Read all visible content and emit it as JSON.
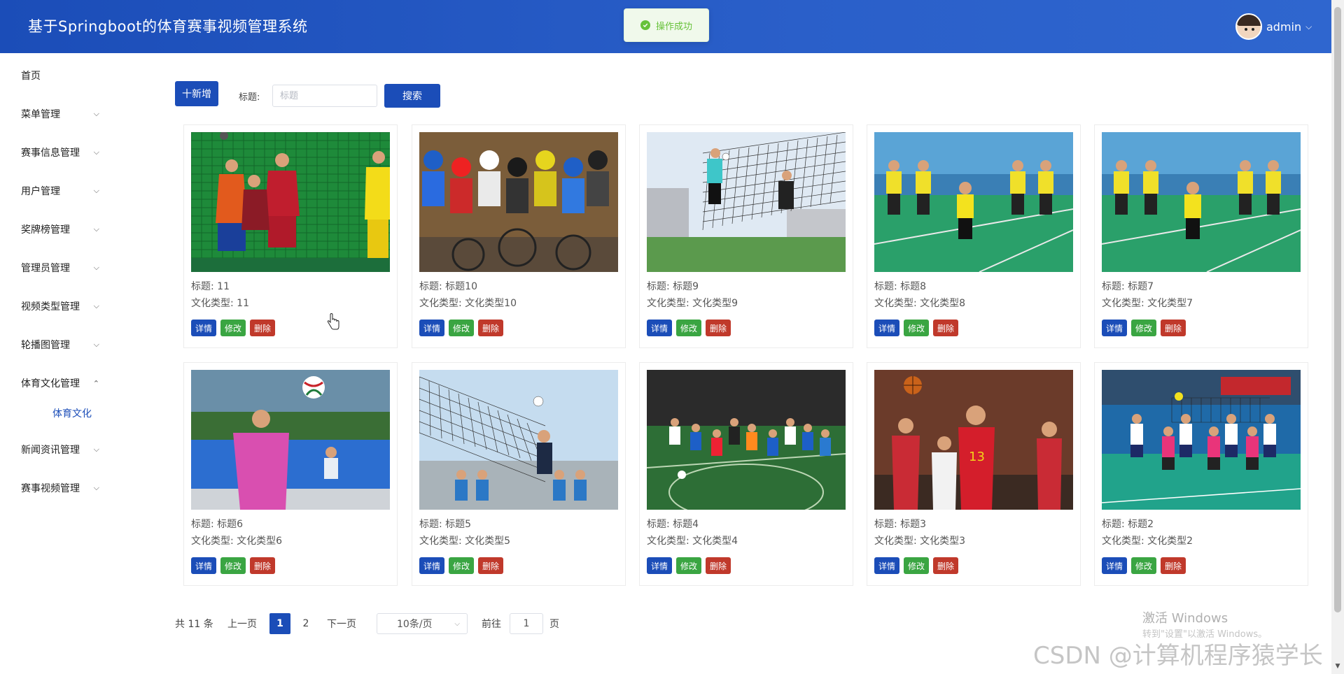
{
  "header": {
    "title": "基于Springboot的体育赛事视频管理系统",
    "toast": "操作成功",
    "username": "admin",
    "caret": "⌵"
  },
  "sidebar": {
    "chevron_down": "⌵",
    "chevron_up": "⌃",
    "items": [
      {
        "label": "首页"
      },
      {
        "label": "菜单管理"
      },
      {
        "label": "赛事信息管理"
      },
      {
        "label": "用户管理"
      },
      {
        "label": "奖牌榜管理"
      },
      {
        "label": "管理员管理"
      },
      {
        "label": "视频类型管理"
      },
      {
        "label": "轮播图管理"
      },
      {
        "label": "体育文化管理"
      },
      {
        "label": "新闻资讯管理"
      },
      {
        "label": "赛事视频管理"
      }
    ],
    "submenu": {
      "label": "体育文化"
    }
  },
  "toolbar": {
    "add_label": "十新增",
    "title_label": "标题:",
    "search_placeholder": "标题",
    "search_label": "搜索"
  },
  "card_actions": {
    "detail": "详情",
    "edit": "修改",
    "delete": "删除"
  },
  "cards": [
    {
      "title": "标题: 11",
      "type": "文化类型: 11",
      "photo": "handball"
    },
    {
      "title": "标题: 标题10",
      "type": "文化类型: 文化类型10",
      "photo": "cycling"
    },
    {
      "title": "标题: 标题9",
      "type": "文化类型: 文化类型9",
      "photo": "volleyball-net"
    },
    {
      "title": "标题: 标题8",
      "type": "文化类型: 文化类型8",
      "photo": "badminton"
    },
    {
      "title": "标题: 标题7",
      "type": "文化类型: 文化类型7",
      "photo": "badminton"
    },
    {
      "title": "标题: 标题6",
      "type": "文化类型: 文化类型6",
      "photo": "volleyball-girl"
    },
    {
      "title": "标题: 标题5",
      "type": "文化类型: 文化类型5",
      "photo": "volleyball-spike"
    },
    {
      "title": "标题: 标题4",
      "type": "文化类型: 文化类型4",
      "photo": "football"
    },
    {
      "title": "标题: 标题3",
      "type": "文化类型: 文化类型3",
      "photo": "basketball"
    },
    {
      "title": "标题: 标题2",
      "type": "文化类型: 文化类型2",
      "photo": "volleyball-court"
    }
  ],
  "pagination": {
    "total": "共 11 条",
    "prev": "上一页",
    "page1": "1",
    "page2": "2",
    "next": "下一页",
    "page_size": "10条/页",
    "goto_label": "前往",
    "goto_value": "1",
    "page_suffix": "页"
  },
  "watermarks": {
    "windows_title": "激活 Windows",
    "windows_sub": "转到\"设置\"以激活 Windows。",
    "csdn": "CSDN @计算机程序猿学长"
  },
  "colors": {
    "primary": "#1b4db8",
    "edit": "#3aa542",
    "delete": "#c0392b",
    "success": "#67c23a"
  }
}
